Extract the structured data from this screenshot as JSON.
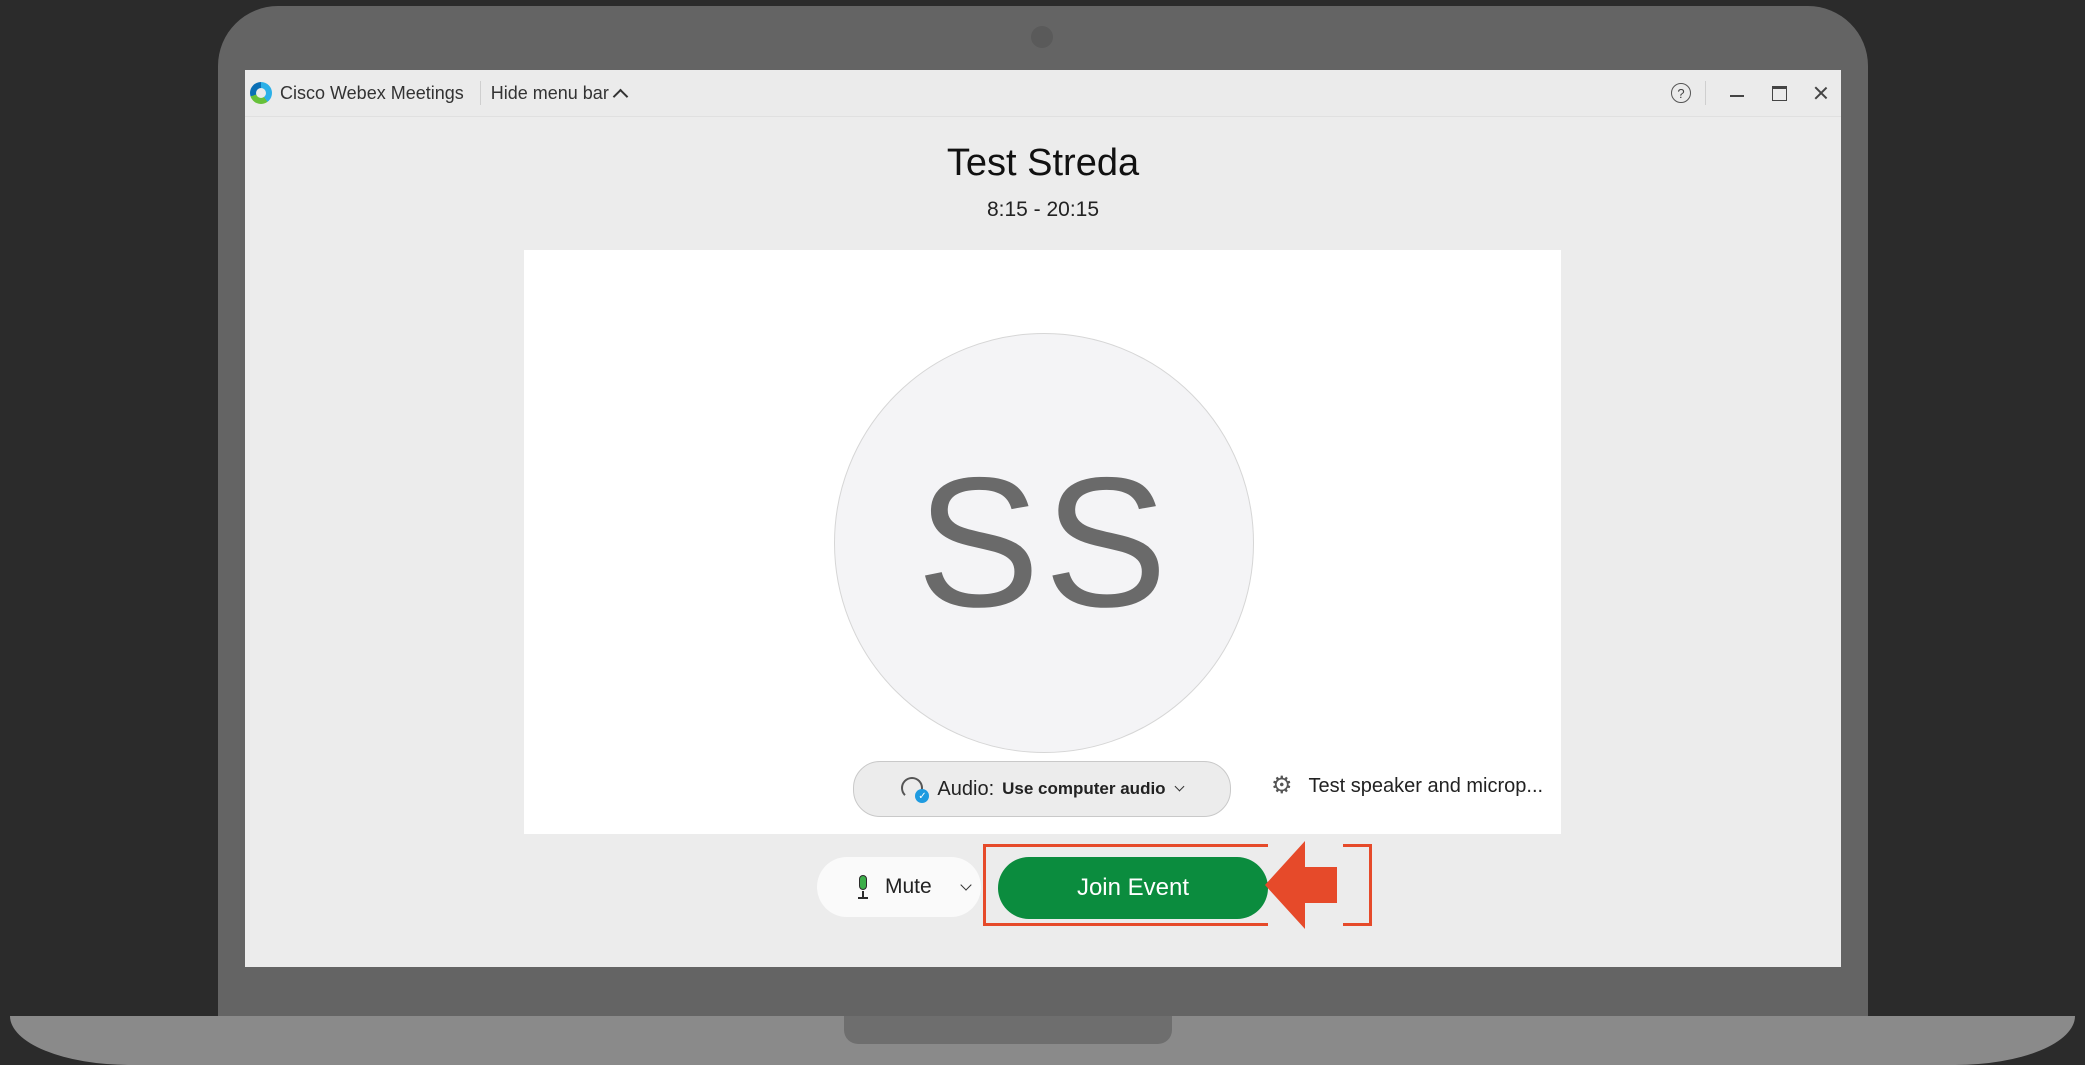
{
  "window": {
    "app_name": "Cisco Webex Meetings",
    "hide_menu_label": "Hide menu bar",
    "help_glyph": "?"
  },
  "meeting": {
    "title": "Test Streda",
    "time": "8:15 - 20:15"
  },
  "preview": {
    "avatar_initials": "SS",
    "audio_label": "Audio:",
    "audio_value": "Use computer audio",
    "test_link": "Test speaker and microp..."
  },
  "actions": {
    "mute_label": "Mute",
    "join_label": "Join Event"
  },
  "colors": {
    "join_button": "#0b8c3e",
    "annotation": "#e64a2a",
    "frame": "#646464",
    "background": "#2b2b2b"
  },
  "icons": [
    "webex-logo-icon",
    "chevron-up-icon",
    "help-icon",
    "minimize-icon",
    "maximize-icon",
    "close-icon",
    "headset-icon",
    "gear-icon",
    "microphone-icon",
    "chevron-down-icon",
    "arrow-left-icon"
  ]
}
